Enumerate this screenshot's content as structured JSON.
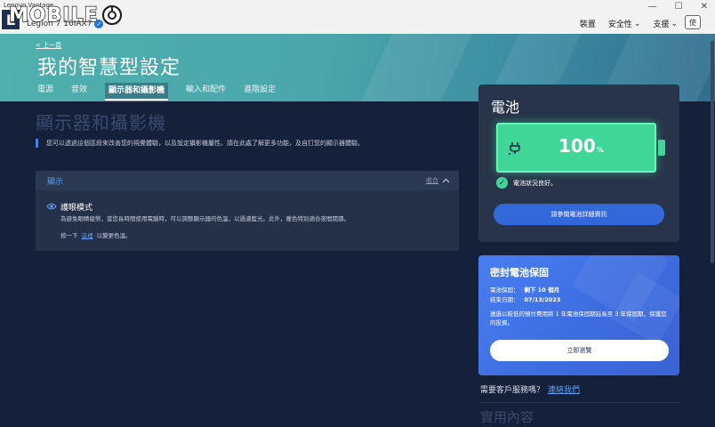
{
  "window": {
    "app_title": "Lenovo Vantage",
    "device_name": "Legion 7 16IAX7",
    "controls": {
      "minimize": "—",
      "maximize": "☐",
      "close": "✕"
    }
  },
  "watermark": {
    "text": "MOBILE"
  },
  "topnav": {
    "items": [
      {
        "label": "裝置"
      },
      {
        "label": "安全性",
        "dropdown": true
      },
      {
        "label": "支援",
        "dropdown": true
      }
    ],
    "avatar": "使"
  },
  "hero": {
    "back_label": "< 上一頁",
    "title": "我的智慧型設定",
    "tabs": [
      {
        "label": "電源"
      },
      {
        "label": "音效"
      },
      {
        "label": "顯示器和攝影機",
        "active": true
      },
      {
        "label": "輸入和配件"
      },
      {
        "label": "進階設定"
      }
    ]
  },
  "main": {
    "section_title": "顯示器和攝影機",
    "description": "您可以透過這個區段來改善您的視覺體驗，以及設定攝影機屬性。請在此處了解更多功能，及自訂您的顯示器體驗。",
    "panel": {
      "title": "顯示",
      "collapse_label": "收合",
      "setting": {
        "name": "護眼模式",
        "description": "為避免眼睛疲勞，當您長時間使用電腦時，可以調整顯示器的色溫，以過濾藍光。此外，暖色特別適合夜間閱讀。",
        "link_prefix": "按一下",
        "link_text": "這裡",
        "link_suffix": "以變更色溫。"
      }
    }
  },
  "battery": {
    "title": "電池",
    "percent": "100",
    "percent_unit": "%",
    "level": 100,
    "status": "電池狀況良好。",
    "details_button": "請參閱電池詳細資訊"
  },
  "warranty": {
    "title": "密封電池保固",
    "warranty_label": "電池保固：",
    "warranty_value": "剩下 10 個月",
    "end_date_label": "結束日期：",
    "end_date_value": "07/13/2023",
    "paragraph": "透過以較低的預付費用將 1 年電池保固期延長至 3 年保固期，保護您的投資。",
    "button": "立即瀏覽"
  },
  "support": {
    "question": "需要客戶服務嗎？",
    "link": "連絡我們"
  },
  "useful": {
    "title": "實用內容"
  },
  "colors": {
    "background": "#15203a",
    "accent_blue": "#3268d7",
    "battery_green": "#3fd698",
    "hero_teal": "#4fb0ad"
  }
}
